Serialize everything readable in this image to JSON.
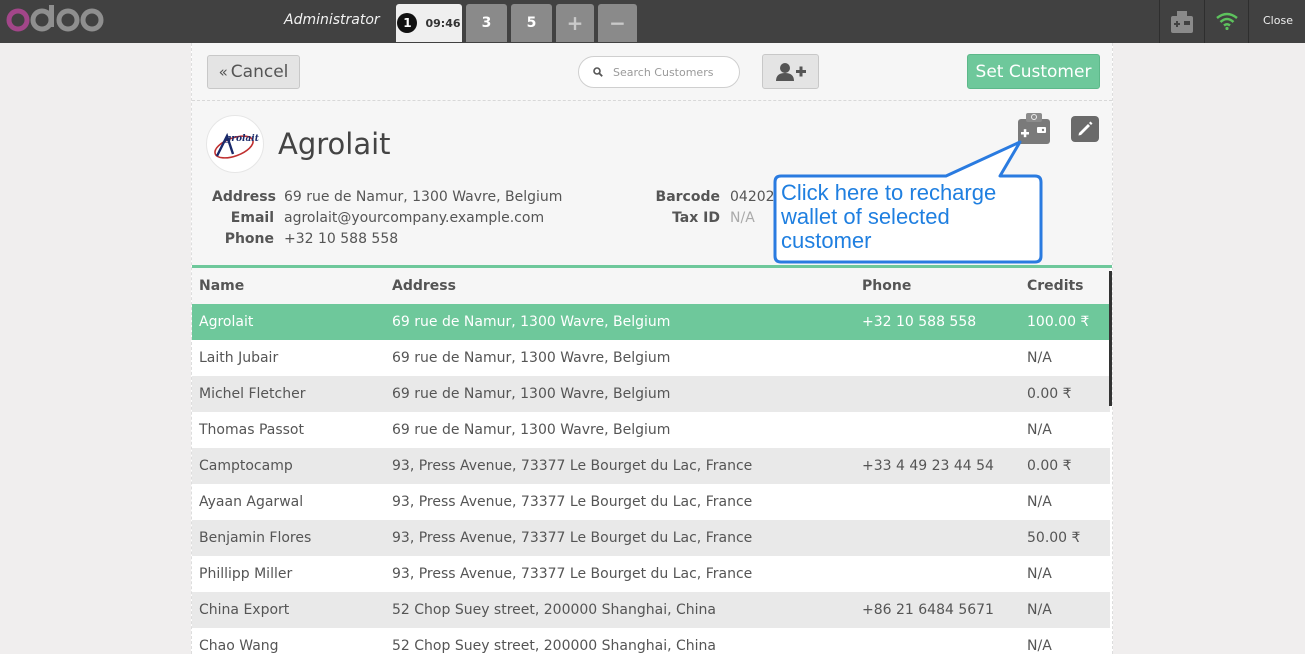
{
  "topbar": {
    "username": "Administrator",
    "orders": [
      {
        "number": "1",
        "time": "09:46"
      },
      {
        "number": "3"
      },
      {
        "number": "5"
      }
    ],
    "add_order_symbol": "+",
    "remove_order_symbol": "−",
    "close_label": "Close"
  },
  "controls": {
    "cancel_label": "Cancel",
    "search_placeholder": "Search Customers",
    "set_customer_label": "Set Customer"
  },
  "customer": {
    "name": "Agrolait",
    "logo_text": "Agrolait",
    "address_label": "Address",
    "address": "69 rue de Namur, 1300 Wavre, Belgium",
    "email_label": "Email",
    "email": "agrolait@yourcompany.example.com",
    "phone_label": "Phone",
    "phone": "+32 10 588 558",
    "barcode_label": "Barcode",
    "barcode": "04202",
    "taxid_label": "Tax ID",
    "taxid": "N/A"
  },
  "list": {
    "headers": {
      "name": "Name",
      "address": "Address",
      "phone": "Phone",
      "credits": "Credits"
    },
    "rows": [
      {
        "name": "Agrolait",
        "address": "69 rue de Namur, 1300 Wavre, Belgium",
        "phone": "+32 10 588 558",
        "credits": "100.00 ₹"
      },
      {
        "name": "Laith Jubair",
        "address": "69 rue de Namur, 1300 Wavre, Belgium",
        "phone": "",
        "credits": "N/A"
      },
      {
        "name": "Michel Fletcher",
        "address": "69 rue de Namur, 1300 Wavre, Belgium",
        "phone": "",
        "credits": "0.00 ₹"
      },
      {
        "name": "Thomas Passot",
        "address": "69 rue de Namur, 1300 Wavre, Belgium",
        "phone": "",
        "credits": "N/A"
      },
      {
        "name": "Camptocamp",
        "address": "93, Press Avenue, 73377 Le Bourget du Lac, France",
        "phone": "+33 4 49 23 44 54",
        "credits": "0.00 ₹"
      },
      {
        "name": "Ayaan Agarwal",
        "address": "93, Press Avenue, 73377 Le Bourget du Lac, France",
        "phone": "",
        "credits": "N/A"
      },
      {
        "name": "Benjamin Flores",
        "address": "93, Press Avenue, 73377 Le Bourget du Lac, France",
        "phone": "",
        "credits": "50.00 ₹"
      },
      {
        "name": "Phillipp Miller",
        "address": "93, Press Avenue, 73377 Le Bourget du Lac, France",
        "phone": "",
        "credits": "N/A"
      },
      {
        "name": "China Export",
        "address": "52 Chop Suey street, 200000 Shanghai, China",
        "phone": "+86 21 6484 5671",
        "credits": "N/A"
      },
      {
        "name": "Chao Wang",
        "address": "52 Chop Suey street, 200000 Shanghai, China",
        "phone": "",
        "credits": "N/A"
      }
    ]
  },
  "callout": {
    "text": "Click here to recharge wallet of selected customer"
  },
  "colors": {
    "accent": "#6ec89b",
    "topbar": "#414141",
    "callout_text": "#1f7fe0",
    "callout_border": "#2a7be0"
  }
}
